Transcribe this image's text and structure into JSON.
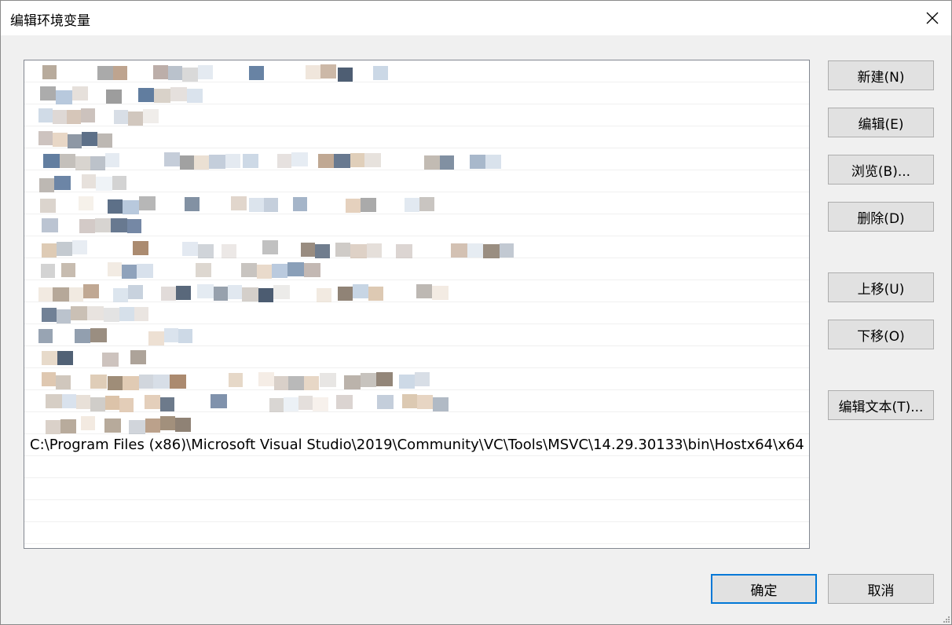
{
  "window": {
    "title": "编辑环境变量",
    "close_icon": "close-icon"
  },
  "list": {
    "selected_entry": "C:\\Program Files (x86)\\Microsoft Visual Studio\\2019\\Community\\VC\\Tools\\MSVC\\14.29.30133\\bin\\Hostx64\\x64",
    "blurred_rows": 17
  },
  "buttons": {
    "new": "新建(N)",
    "edit": "编辑(E)",
    "browse": "浏览(B)...",
    "delete": "删除(D)",
    "move_up": "上移(U)",
    "move_down": "下移(O)",
    "edit_text": "编辑文本(T)...",
    "ok": "确定",
    "cancel": "取消"
  },
  "colors": {
    "accent": "#0078d7",
    "button_bg": "#e1e1e1",
    "window_bg": "#f0f0f0"
  }
}
